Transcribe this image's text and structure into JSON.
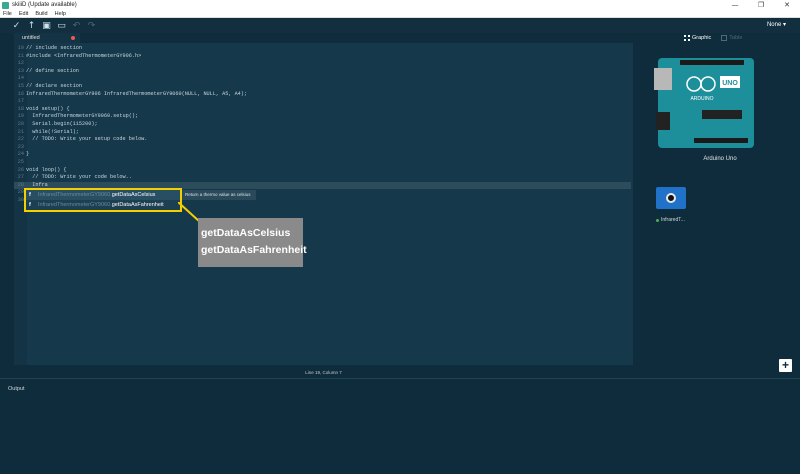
{
  "window": {
    "title": "skiiiD (Update available)",
    "controls": [
      "—",
      "❐",
      "✕"
    ]
  },
  "menu": [
    "File",
    "Edit",
    "Build",
    "Help"
  ],
  "toolbar": {
    "board_select": "None ▾"
  },
  "editor": {
    "tab_name": "untitled",
    "lines": [
      {
        "n": "10",
        "text": "// include section",
        "cls": "c-comment"
      },
      {
        "n": "11",
        "text": "#include <InfraredThermometerGY906.h>",
        "cls": "c-str"
      },
      {
        "n": "12",
        "text": "",
        "cls": ""
      },
      {
        "n": "13",
        "text": "// define section",
        "cls": "c-comment"
      },
      {
        "n": "14",
        "text": "",
        "cls": ""
      },
      {
        "n": "15",
        "text": "// declare section",
        "cls": "c-comment"
      },
      {
        "n": "16",
        "text": "InfraredThermometerGY906 InfraredThermometerGY9060(NULL, NULL, A5, A4);",
        "cls": "c-fn"
      },
      {
        "n": "17",
        "text": "",
        "cls": ""
      },
      {
        "n": "18",
        "text": "void setup() {",
        "cls": "c-kw"
      },
      {
        "n": "19",
        "text": "  InfraredThermometerGY9060.setup();",
        "cls": "c-fn"
      },
      {
        "n": "20",
        "text": "  Serial.begin(115200);",
        "cls": "c-fn"
      },
      {
        "n": "21",
        "text": "  while(!Serial);",
        "cls": "c-fn"
      },
      {
        "n": "22",
        "text": "  // TODO: Write your setup code below.",
        "cls": "c-comment"
      },
      {
        "n": "23",
        "text": "",
        "cls": ""
      },
      {
        "n": "24",
        "text": "}",
        "cls": ""
      },
      {
        "n": "25",
        "text": "",
        "cls": ""
      },
      {
        "n": "26",
        "text": "void loop() {",
        "cls": "c-kw"
      },
      {
        "n": "27",
        "text": "  // TODO: Write your code below..",
        "cls": "c-comment"
      },
      {
        "n": "28",
        "text": "  Infra",
        "cls": ""
      },
      {
        "n": "29",
        "text": "}",
        "cls": ""
      },
      {
        "n": "30",
        "text": "",
        "cls": ""
      }
    ],
    "active_line_index": 18
  },
  "autocomplete": {
    "items": [
      {
        "icon": "f",
        "ns": "InfraredThermometerGY9060.",
        "name": "getDataAsCelsius"
      },
      {
        "icon": "f",
        "ns": "InfraredThermometerGY9060.",
        "name": "getDataAsFahrenheit"
      }
    ],
    "tooltip": "Return a thermo value as celsius"
  },
  "callout": {
    "line1": "getDataAsCelsius",
    "line2": "getDataAsFahrenheit"
  },
  "status": {
    "cursor": "Line 19, Column 7"
  },
  "output": {
    "label": "Output"
  },
  "right_panel": {
    "view_tabs": {
      "graphic": "Graphic",
      "table": "Table"
    },
    "board_name": "Arduino Uno",
    "board_marks": {
      "brand": "ARDUINO",
      "model": "UNO"
    },
    "module_label": "InfraredT..."
  },
  "colors": {
    "background": "#0f2c3c",
    "editor": "#16384b",
    "callout_border": "#f4d000",
    "board": "#1d8f9b"
  }
}
